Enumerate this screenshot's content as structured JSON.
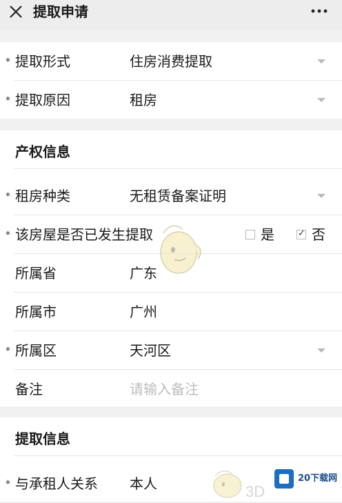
{
  "header": {
    "title": "提取申请",
    "icons": {
      "close": "close-icon",
      "more": "more-icon"
    }
  },
  "section_basic": {
    "rows": [
      {
        "required": "*",
        "label": "提取形式",
        "value": "住房消费提取",
        "control": "dropdown"
      },
      {
        "required": "*",
        "label": "提取原因",
        "value": "租房",
        "control": "dropdown"
      }
    ]
  },
  "section_property": {
    "title": "产权信息",
    "rent_type": {
      "required": "*",
      "label": "租房种类",
      "value": "无租赁备案证明"
    },
    "withdrawn": {
      "required": "*",
      "label": "该房屋是否已发生提取",
      "options": [
        {
          "label": "是",
          "checked": false
        },
        {
          "label": "否",
          "checked": true
        }
      ],
      "check_glyph": "✓"
    },
    "province": {
      "label": "所属省",
      "value": "广东"
    },
    "city": {
      "label": "所属市",
      "value": "广州"
    },
    "district": {
      "required": "*",
      "label": "所属区",
      "value": "天河区"
    },
    "remark": {
      "label": "备注",
      "placeholder": "请输入备注"
    }
  },
  "section_withdraw": {
    "title": "提取信息",
    "relation": {
      "required": "*",
      "label": "与承租人关系",
      "value": "本人"
    }
  },
  "watermark": {
    "brand": "20下载网",
    "text3d": "3D"
  },
  "colors": {
    "accent_blue": "#1b6ec2",
    "placeholder": "#bdbdbd",
    "caret": "#b9b9b9"
  }
}
